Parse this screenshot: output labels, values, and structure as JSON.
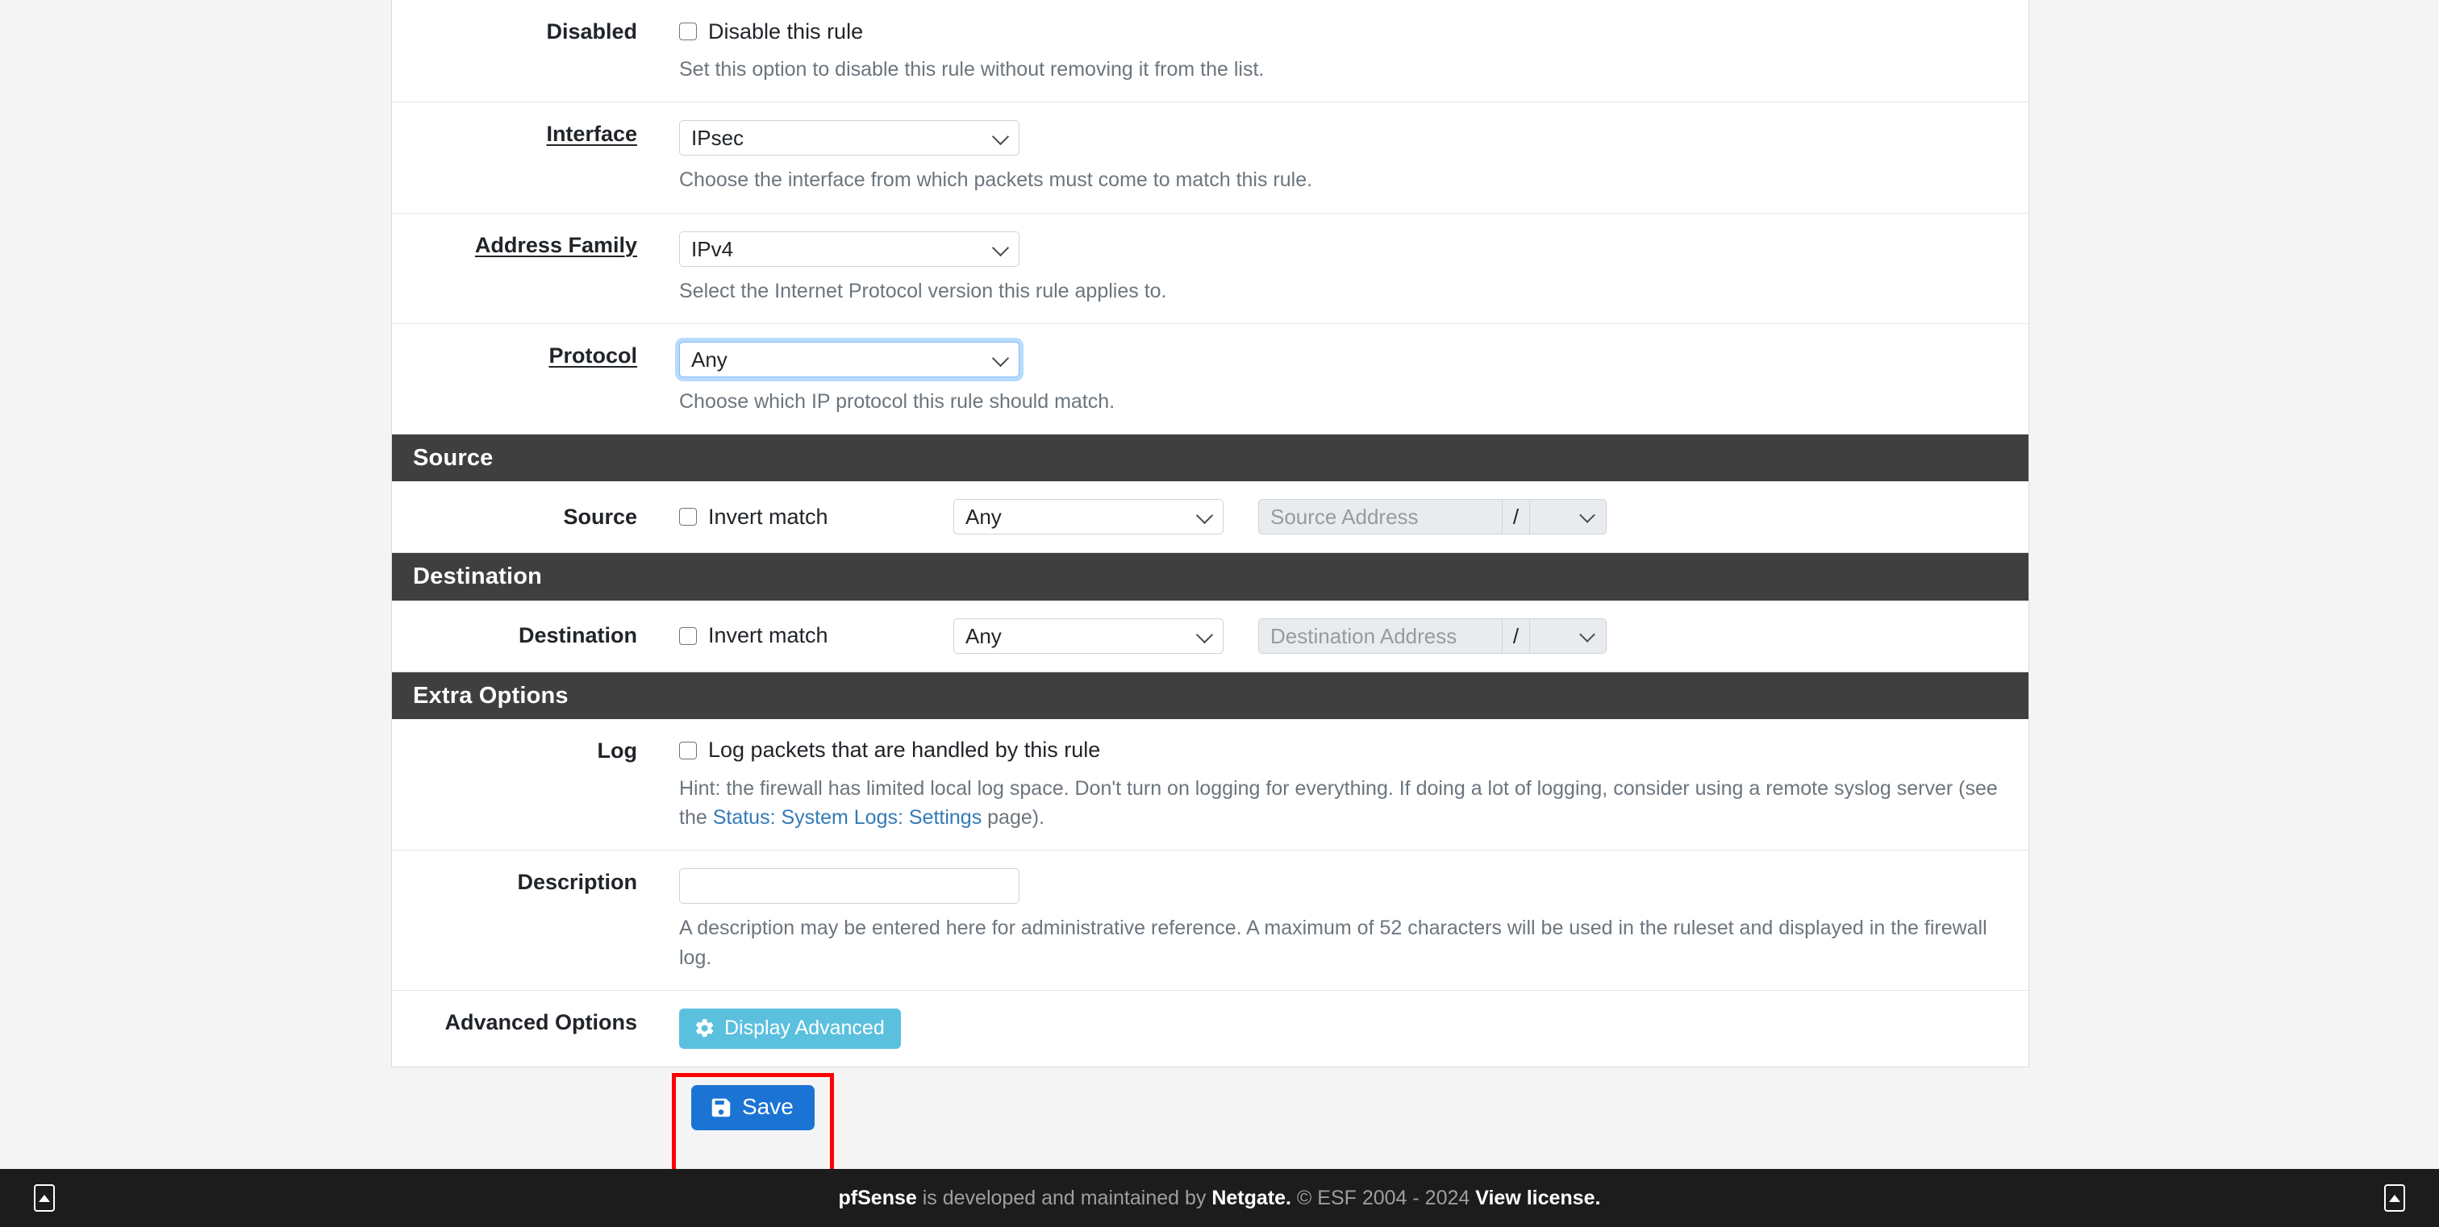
{
  "form": {
    "rows": [
      {
        "label": "Disabled",
        "underline": false,
        "checkbox_label": "Disable this rule",
        "help": "Set this option to disable this rule without removing it from the list."
      },
      {
        "label": "Interface",
        "underline": true,
        "value": "IPsec",
        "help": "Choose the interface from which packets must come to match this rule."
      },
      {
        "label": "Address Family",
        "underline": true,
        "value": "IPv4",
        "help": "Select the Internet Protocol version this rule applies to."
      },
      {
        "label": "Protocol",
        "underline": true,
        "value": "Any",
        "help": "Choose which IP protocol this rule should match.",
        "focused": true
      }
    ]
  },
  "source": {
    "heading": "Source",
    "label": "Source",
    "invert_label": "Invert match",
    "type_value": "Any",
    "address_placeholder": "Source Address",
    "slash": "/",
    "cidr_value": ""
  },
  "destination": {
    "heading": "Destination",
    "label": "Destination",
    "invert_label": "Invert match",
    "type_value": "Any",
    "address_placeholder": "Destination Address",
    "slash": "/",
    "cidr_value": ""
  },
  "extra_options": {
    "heading": "Extra Options",
    "log": {
      "label": "Log",
      "checkbox_label": "Log packets that are handled by this rule",
      "help_part1": "Hint: the firewall has limited local log space. Don't turn on logging for everything. If doing a lot of logging, consider using a remote syslog server (see the ",
      "help_link": "Status: System Logs: Settings",
      "help_part2": " page)."
    },
    "description": {
      "label": "Description",
      "value": "",
      "help": "A description may be entered here for administrative reference. A maximum of 52 characters will be used in the ruleset and displayed in the firewall log."
    },
    "advanced": {
      "label": "Advanced Options",
      "button_label": "Display Advanced",
      "button_color": "#5bc0de"
    }
  },
  "actions": {
    "save_label": "Save",
    "save_color": "#1b74d4",
    "highlight_color": "#ff0000"
  },
  "footer": {
    "brand": "pfSense",
    "text_mid": " is developed and maintained by ",
    "company": "Netgate.",
    "copyright": " © ESF 2004 - 2024 ",
    "license": "View license."
  }
}
